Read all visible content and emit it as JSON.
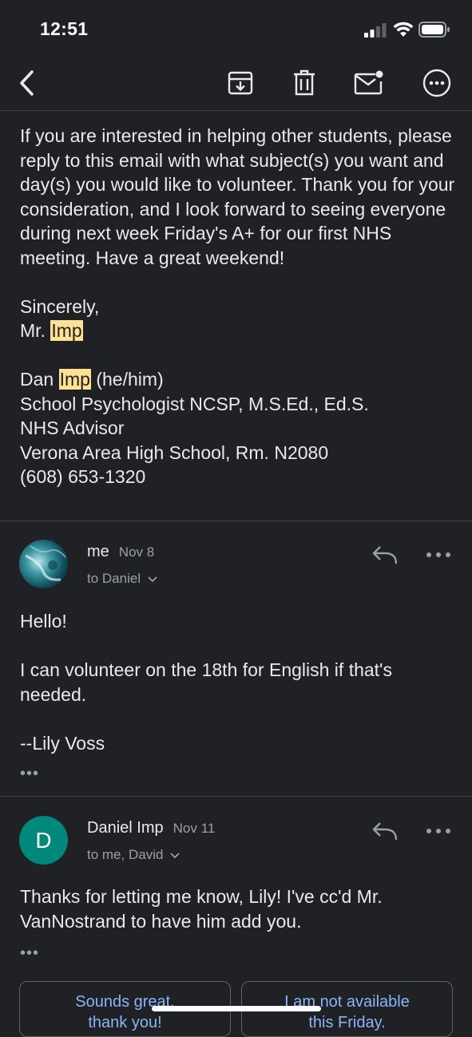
{
  "status_bar": {
    "time": "12:51"
  },
  "toolbar": {
    "back_icon": "chevron-left-icon",
    "archive_icon": "archive-icon",
    "delete_icon": "trash-icon",
    "unread_icon": "mark-unread-icon",
    "more_icon": "more-circle-icon"
  },
  "message1": {
    "paragraph": "If you are interested in helping other students, please reply to this email with what subject(s) you want and day(s) you would like to volunteer. Thank you for your consideration, and I look forward to seeing everyone during next week Friday's A+ for our first NHS meeting. Have a great weekend!",
    "closing": "Sincerely,",
    "sign_prefix": "Mr.",
    "sign_name": "Imp",
    "sig_first": "Dan",
    "sig_last": "Imp",
    "sig_pronouns": "(he/him)",
    "sig_title": "School Psychologist NCSP, M.S.Ed., Ed.S.",
    "sig_role": "NHS Advisor",
    "sig_school": "Verona Area High School, Rm. N2080",
    "sig_phone": "(608) 653-1320"
  },
  "message2": {
    "sender": "me",
    "date": "Nov 8",
    "to": "to Daniel",
    "greeting": "Hello!",
    "body": "I can volunteer on the 18th for English if that's needed.",
    "signoff": "--Lily Voss",
    "ellipsis": "•••"
  },
  "message3": {
    "avatar_letter": "D",
    "avatar_color": "#00897b",
    "sender": "Daniel Imp",
    "date": "Nov 11",
    "to": "to me, David",
    "body": "Thanks for letting me know, Lily! I've cc'd Mr. VanNostrand to have him add you.",
    "ellipsis": "•••"
  },
  "smart_replies": [
    {
      "line1": "Sounds great,",
      "line2": "thank you!"
    },
    {
      "line1": "I am not available",
      "line2": "this Friday."
    }
  ],
  "colors": {
    "background": "#202124",
    "text": "#e8eaed",
    "secondary_text": "#9aa0a6",
    "highlight": "#fde293",
    "link": "#8ab4f8"
  }
}
